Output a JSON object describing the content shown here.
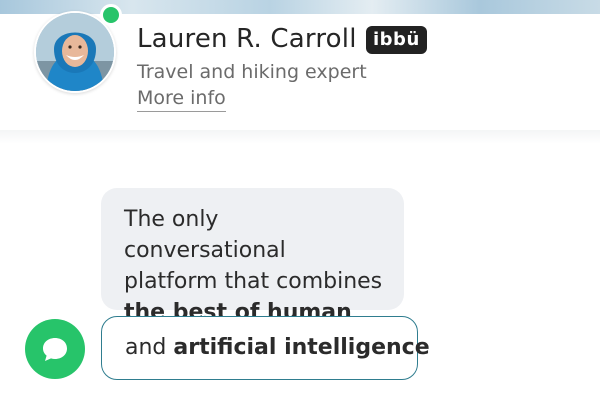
{
  "header": {
    "name": "Lauren R. Carroll",
    "badge": "ibbü",
    "role": "Travel and hiking expert",
    "more_info": "More info"
  },
  "messages": {
    "first": {
      "line1": "The only conversational",
      "line2": "platform that combines",
      "line3_bold": "the best of human"
    },
    "second": {
      "plain": "and",
      "bold": "artificial intelligence"
    }
  },
  "colors": {
    "online": "#27c46a",
    "chat_icon_bg": "#27c46a",
    "bubble_bg": "#eef0f3",
    "outline_bubble_border": "#2f7d8f",
    "badge_bg": "#222222"
  },
  "icons": {
    "chat_avatar": "speech-bubble-icon"
  }
}
